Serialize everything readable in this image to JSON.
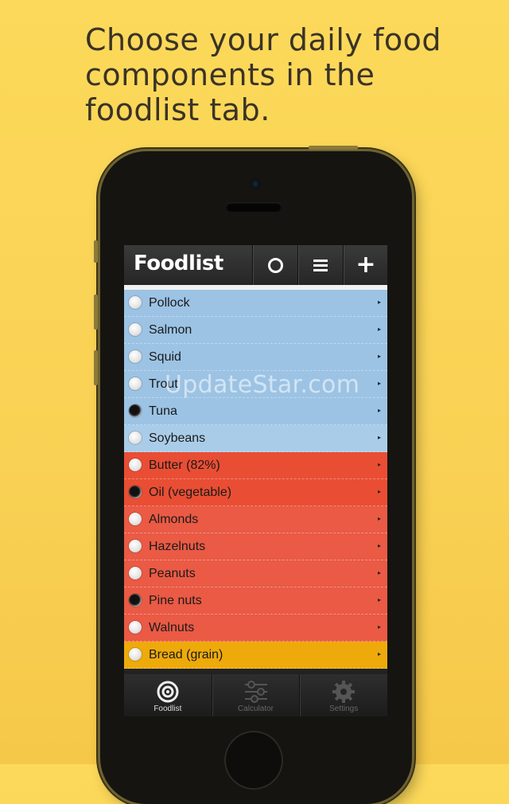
{
  "headline": "Choose your daily food components in the foodlist tab.",
  "watermark": "UpdateStar.com",
  "navbar": {
    "title": "Foodlist",
    "buttons": [
      {
        "icon": "circle-icon"
      },
      {
        "icon": "list-icon"
      },
      {
        "icon": "plus-icon",
        "label": "+"
      }
    ]
  },
  "foods": [
    {
      "label": "Pollock",
      "selected": false,
      "color": "#9cc3e4"
    },
    {
      "label": "Salmon",
      "selected": false,
      "color": "#9cc3e4"
    },
    {
      "label": "Squid",
      "selected": false,
      "color": "#9cc3e4"
    },
    {
      "label": "Trout",
      "selected": false,
      "color": "#9cc3e4"
    },
    {
      "label": "Tuna",
      "selected": true,
      "color": "#9cc3e4"
    },
    {
      "label": "Soybeans",
      "selected": false,
      "color": "#a9cde9"
    },
    {
      "label": "Butter (82%)",
      "selected": false,
      "color": "#e94e34"
    },
    {
      "label": "Oil (vegetable)",
      "selected": true,
      "color": "#e94e34"
    },
    {
      "label": "Almonds",
      "selected": false,
      "color": "#ea5a45"
    },
    {
      "label": "Hazelnuts",
      "selected": false,
      "color": "#ea5a45"
    },
    {
      "label": "Peanuts",
      "selected": false,
      "color": "#ea5a45"
    },
    {
      "label": "Pine nuts",
      "selected": true,
      "color": "#ea5a45"
    },
    {
      "label": "Walnuts",
      "selected": false,
      "color": "#ea5a45"
    },
    {
      "label": "Bread (grain)",
      "selected": false,
      "color": "#eeaa0b"
    }
  ],
  "tabs": [
    {
      "label": "Foodlist",
      "icon": "target-icon",
      "active": true
    },
    {
      "label": "Calculator",
      "icon": "sliders-icon",
      "active": false
    },
    {
      "label": "Settings",
      "icon": "gear-icon",
      "active": false
    }
  ]
}
